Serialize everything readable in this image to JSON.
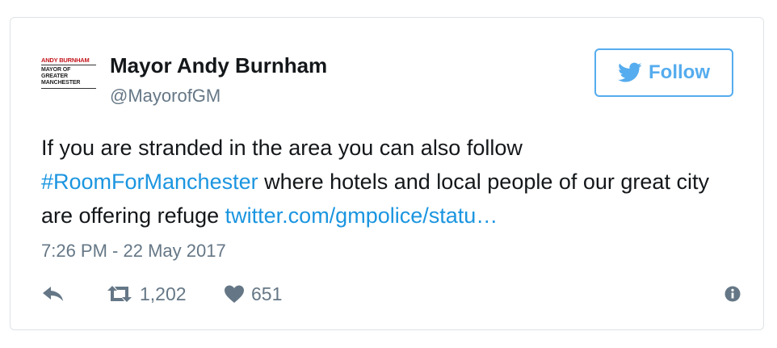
{
  "author": {
    "name": "Mayor Andy Burnham",
    "handle": "@MayorofGM",
    "avatar": {
      "line1": "ANDY BURNHAM",
      "line2": "MAYOR OF",
      "line3": "GREATER",
      "line4": "MANCHESTER"
    }
  },
  "follow_button": {
    "label": "Follow",
    "icon": "twitter-bird-icon"
  },
  "tweet": {
    "text_part1": "If you are stranded in the area you can also follow ",
    "hashtag": "#RoomForManchester",
    "text_part2": " where hotels and local people of our great city are offering refuge ",
    "link": "twitter.com/gmpolice/statu…",
    "timestamp": "7:26 PM - 22 May 2017"
  },
  "actions": {
    "reply_icon": "reply-icon",
    "retweet_icon": "retweet-icon",
    "retweet_count": "1,202",
    "like_icon": "heart-icon",
    "like_count": "651",
    "info_icon": "info-icon"
  },
  "colors": {
    "accent": "#55acee",
    "link": "#1b95e0",
    "text": "#14171a",
    "muted": "#657786",
    "avatar_red": "#c4161c"
  }
}
